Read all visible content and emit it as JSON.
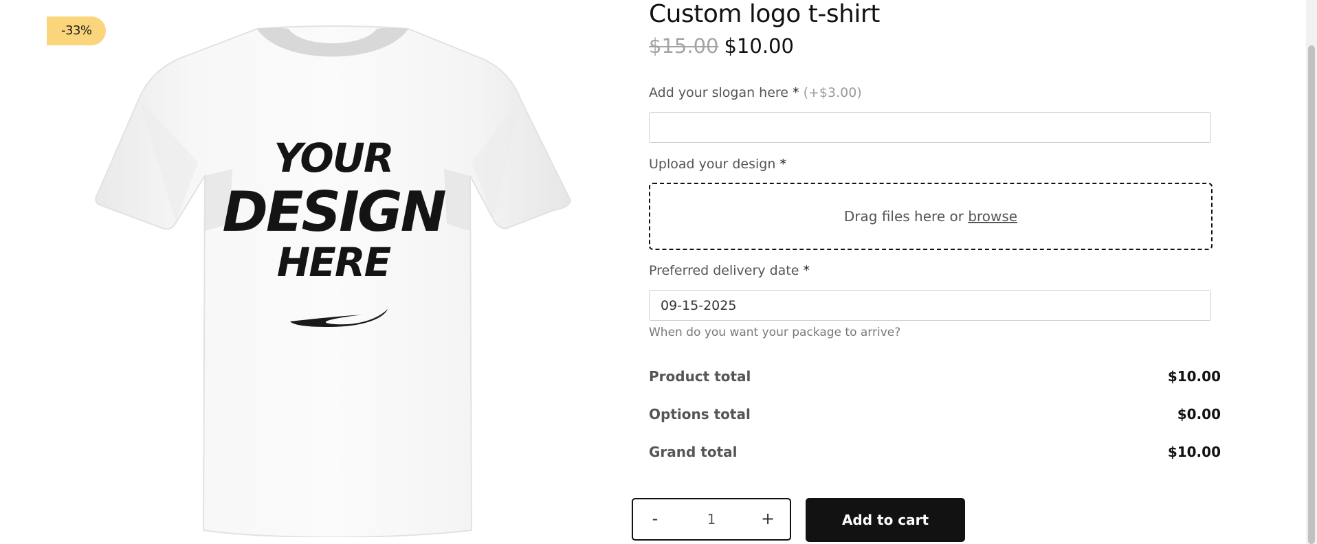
{
  "product": {
    "title": "Custom logo t-shirt",
    "price_old": "$15.00",
    "price_new": "$10.00",
    "sale_badge": "-33%",
    "image": {
      "line1": "YOUR",
      "line2": "DESIGN",
      "line3": "HERE"
    }
  },
  "form": {
    "slogan": {
      "label": "Add your slogan here",
      "required_mark": "*",
      "extra": "(+$3.00)",
      "value": ""
    },
    "upload": {
      "label": "Upload your design",
      "required_mark": "*",
      "dropzone_text": "Drag files here or",
      "browse_link": "browse"
    },
    "delivery": {
      "label": "Preferred delivery date",
      "required_mark": "*",
      "value": "09-15-2025",
      "help": "When do you want your package to arrive?"
    }
  },
  "totals": [
    {
      "label": "Product total",
      "value": "$10.00"
    },
    {
      "label": "Options total",
      "value": "$0.00"
    },
    {
      "label": "Grand total",
      "value": "$10.00"
    }
  ],
  "cart": {
    "minus_label": "-",
    "quantity": "1",
    "plus_label": "+",
    "add_label": "Add to cart"
  },
  "colors": {
    "badge": "#fbd57b",
    "button": "#121212",
    "muted_text": "#555555"
  }
}
